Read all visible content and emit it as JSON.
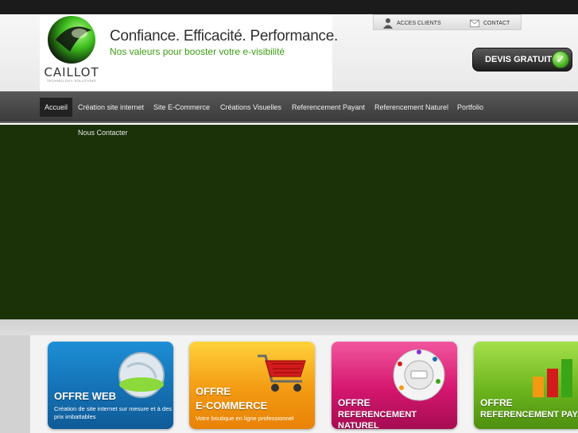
{
  "brand": {
    "name": "CAILLOT",
    "sub": "TECHNOLOGY SOLUTIONS",
    "tagline": "Confiance. Efficacité. Performance.",
    "subtagline": "Nos valeurs pour booster votre e-visibilité",
    "accent": "#3a9e12"
  },
  "topmenu": {
    "clients": "ACCES CLIENTS",
    "contact": "CONTACT",
    "clients_icon": "user-icon",
    "contact_icon": "envelope-icon"
  },
  "devis": {
    "label": "DEVIS GRATUIT",
    "icon": "check-icon"
  },
  "nav": {
    "items": [
      "Accueil",
      "Création site internet",
      "Site E-Commerce",
      "Créations Visuelles",
      "Referencement Payant",
      "Referencement Naturel",
      "Portfolio",
      "Nous Contacter"
    ],
    "active": "Accueil"
  },
  "slider": {
    "color": "#1b3108"
  },
  "offers": [
    {
      "title_line1": "OFFRE WEB",
      "title_line2": "",
      "desc": "Création de site internet sur mesure et à des prix imbattables",
      "color": "#1d6fb3",
      "icon": "globe-icon"
    },
    {
      "title_line1": "OFFRE",
      "title_line2": "E-COMMERCE",
      "desc": "Votre boutique en ligne professionnel",
      "color": "#f39a12",
      "icon": "shopping-cart-icon"
    },
    {
      "title_line1": "OFFRE",
      "title_line2": "REFERENCEMENT NATUREL",
      "desc": "",
      "color": "#d4166f",
      "icon": "search-engines-icon"
    },
    {
      "title_line1": "OFFRE",
      "title_line2": "REFERENCEMENT PAYANT",
      "desc": "",
      "color": "#6cb51e",
      "icon": "bar-chart-icon"
    }
  ]
}
